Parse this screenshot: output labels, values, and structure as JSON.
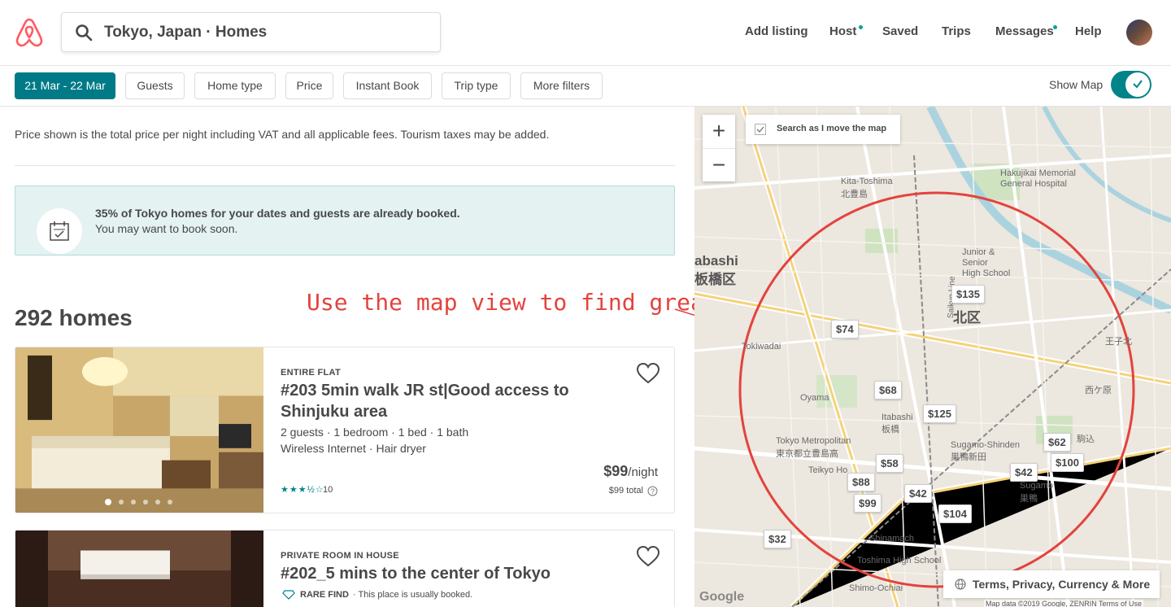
{
  "header": {
    "search_text": "Tokyo, Japan · Homes",
    "nav": [
      "Add listing",
      "Host",
      "Saved",
      "Trips",
      "Messages",
      "Help"
    ]
  },
  "filters": {
    "dates": "21 Mar - 22 Mar",
    "chips": [
      "Guests",
      "Home type",
      "Price",
      "Instant Book",
      "Trip type",
      "More filters"
    ],
    "show_map_label": "Show Map",
    "show_map_on": true
  },
  "notice": {
    "price_note": "Price shown is the total price per night including VAT and all applicable fees. Tourism taxes may be added.",
    "alert_bold": "35% of Tokyo homes for your dates and guests are already booked.",
    "alert_sub": "You may want to book soon."
  },
  "results": {
    "count": "292 homes",
    "annotation": "Use the map view to find great locations"
  },
  "listings": [
    {
      "type": "ENTIRE FLAT",
      "title": "#203 5min walk JR st|Good access to Shinjuku area",
      "details": "2 guests · 1 bedroom · 1 bed · 1 bath",
      "amenities": "Wireless Internet · Hair dryer",
      "price": "$99",
      "per": "/night",
      "total": "$99 total",
      "stars": "★★★½☆",
      "reviews": "10"
    },
    {
      "type": "PRIVATE ROOM IN HOUSE",
      "title": "#202_5 mins to the center of Tokyo",
      "rare_find": "RARE FIND",
      "rare_note": "· This place is usually booked."
    }
  ],
  "map": {
    "search_as_move": "Search as I move the map",
    "zoom_in": "+",
    "zoom_out": "−",
    "pins": [
      "$135",
      "$74",
      "$68",
      "$125",
      "$62",
      "$58",
      "$100",
      "$42",
      "$88",
      "$42",
      "$99",
      "$104",
      "$32"
    ],
    "labels": {
      "itabashi": "abashi",
      "itabashi_kanji": "板橋区",
      "kita_kanji": "北区",
      "kita_toshima": "Kita-Toshima",
      "kita_toshima_kanji": "北豊島",
      "hakujikai": "Hakujikai Memorial",
      "hakujikai2": "General Hospital",
      "juniors": "Junior &",
      "juniors2": "Senior",
      "juniors3": "High School",
      "toshima_label": "Toshima",
      "tokyo_metro": "Tokyo Metropolitan",
      "tokyo_metro2": "東京都立豊島高",
      "teikyo": "Teikyo Ho",
      "sugamo": "Sugamo-Shinden",
      "sugamo_kanji": "巣鴨新田",
      "sugamo2": "Sugamo",
      "sugamo2_kanji": "巣鴨",
      "shinamachi": "Shinamach",
      "toshima_high": "Toshima High School",
      "shimo_ochiai": "Shimo-Ochiai",
      "oyama": "Oyama",
      "itabashi_w": "Itabashi",
      "itabashi_w_kanji": "板橋",
      "tokiwadai": "Tokiwadai",
      "saikyo_line": "Saikyo Line",
      "oji": "王子北",
      "nishigahara": "西ケ原",
      "komagome": "駒込"
    },
    "terms": "Terms, Privacy, Currency & More",
    "google": "Google",
    "map_data": "Map data ©2019 Google, ZENRIN   Terms of Use"
  }
}
